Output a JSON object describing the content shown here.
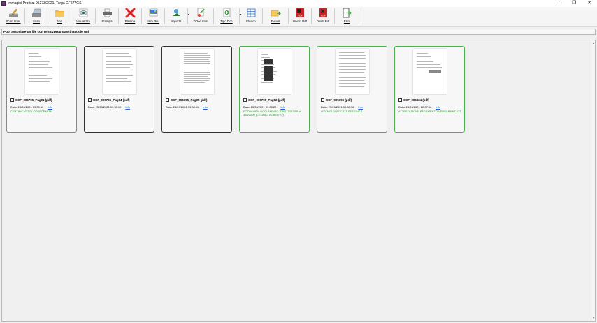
{
  "window": {
    "title": "Immagini Pratica: 95273/2021, Targa GF677GS",
    "controls": [
      "–",
      "❐",
      "✕"
    ]
  },
  "toolbar": [
    {
      "key": "scan-imm",
      "label": "Scan Imm.",
      "icon": "scanner-pen-icon",
      "underline": true
    },
    {
      "key": "scan",
      "label": "Scan",
      "icon": "scanner-icon",
      "underline": true
    },
    {
      "key": "apri",
      "label": "Apri",
      "icon": "folder-icon",
      "underline": true
    },
    {
      "key": "visualizza",
      "label": "Visualizza",
      "icon": "eye-icon",
      "underline": true
    },
    {
      "key": "stampa",
      "label": "Stampa",
      "icon": "printer-icon",
      "underline": false
    },
    {
      "key": "elimina",
      "label": "Elimina",
      "icon": "delete-x-icon",
      "underline": true
    },
    {
      "key": "imm-ris",
      "label": "Imm Ris.",
      "icon": "image-restore-icon",
      "underline": true
    },
    {
      "key": "importa",
      "label": "Importa",
      "icon": "import-icon",
      "underline": false,
      "dropdown": true
    },
    {
      "key": "tidoc",
      "label": "TiDoc.Imm",
      "icon": "doc-type-icon",
      "underline": false
    },
    {
      "key": "tipo-doc",
      "label": "Tipo Doc",
      "icon": "doc-add-icon",
      "underline": true,
      "dropdown": true
    },
    {
      "key": "elenco",
      "label": "Elenco",
      "icon": "list-grid-icon",
      "underline": false
    },
    {
      "key": "email",
      "label": "E-mail",
      "icon": "email-icon",
      "underline": true
    },
    {
      "key": "unisci-pdf",
      "label": "Unisci Pdf",
      "icon": "merge-pdf-icon",
      "underline": false
    },
    {
      "key": "dividi-pdf",
      "label": "Dividi Pdf",
      "icon": "split-pdf-icon",
      "underline": false
    },
    {
      "key": "esci",
      "label": "Esci",
      "icon": "exit-icon",
      "underline": true
    }
  ],
  "dropbar": {
    "text": "Puoi associare un file con Drag&Drop trascinandolo qui"
  },
  "documents": [
    {
      "name": "CCF_005795_Pag01 (pdf)",
      "date": "Data: 23/09/2021 09:30:10",
      "info": "Info",
      "desc": "CERTIFICATO DI CONFORMITA'",
      "border": "green"
    },
    {
      "name": "CCF_005795_Pag04 (pdf)",
      "date": "Data: 23/09/2021 09:30:10",
      "info": "Info",
      "desc": "",
      "border": "dark"
    },
    {
      "name": "CCF_005795_Pag05 (pdf)",
      "date": "Data: 23/09/2021 09:30:11",
      "info": "Info",
      "desc": "",
      "border": "dark"
    },
    {
      "name": "CCF_005795_Pag02 (pdf)",
      "date": "Data: 23/09/2021 09:30:22",
      "info": "Info",
      "desc": "FOTOCOPIA DOCUMENTO IDENTITA DPR n. 358/2000 (CELANO ROBERTO)",
      "border": "green"
    },
    {
      "name": "CCF_005796 (pdf)",
      "date": "Data: 23/09/2021 09:30:36",
      "info": "Info",
      "desc": "ISTANZA UNIFICATA SEZIONE 1",
      "border": "green"
    },
    {
      "name": "CCF_005824 (pdf)",
      "date": "Data: 23/09/2021 12:07:16",
      "info": "Info",
      "desc": "ATTESTAZIONE PAGAMENTO VERSAMENTI CT",
      "border": "green"
    }
  ]
}
